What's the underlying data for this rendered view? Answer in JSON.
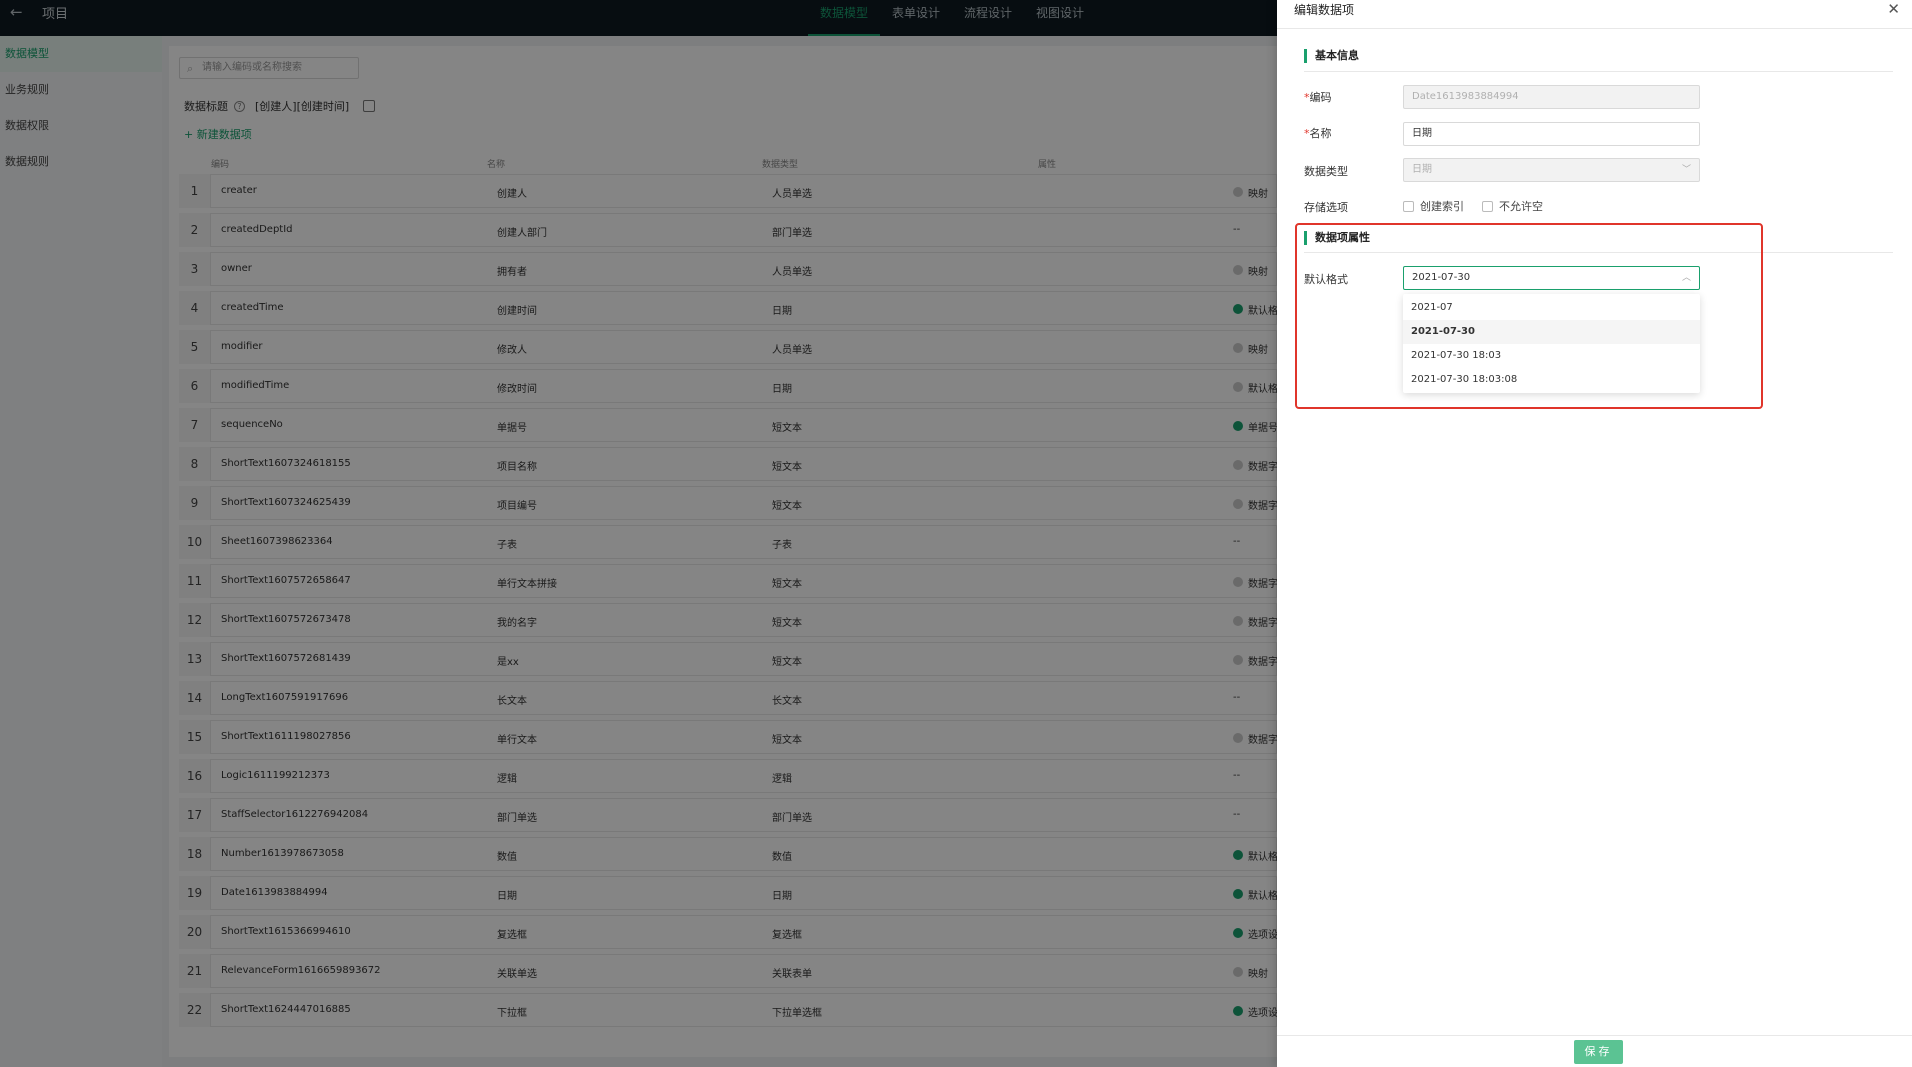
{
  "topbar": {
    "back_icon": "arrow-left-icon",
    "title": "项目",
    "tabs": [
      {
        "label": "数据模型",
        "active": true
      },
      {
        "label": "表单设计",
        "active": false
      },
      {
        "label": "流程设计",
        "active": false
      },
      {
        "label": "视图设计",
        "active": false
      }
    ]
  },
  "sidebar": {
    "items": [
      {
        "label": "数据模型",
        "active": true
      },
      {
        "label": "业务规则",
        "active": false
      },
      {
        "label": "数据权限",
        "active": false
      },
      {
        "label": "数据规则",
        "active": false
      }
    ]
  },
  "main": {
    "search_placeholder": "请输入编码或名称搜索",
    "data_title_label": "数据标题",
    "data_title_value": "[创建人][创建时间]",
    "add_item": "+ 新建数据项",
    "columns": [
      "编码",
      "名称",
      "数据类型",
      "属性"
    ],
    "rows": [
      {
        "n": "1",
        "code": "creater",
        "name": "创建人",
        "type": "人员单选",
        "attr": "映射",
        "dot": "gray"
      },
      {
        "n": "2",
        "code": "createdDeptId",
        "name": "创建人部门",
        "type": "部门单选",
        "attr": "--",
        "dot": "none"
      },
      {
        "n": "3",
        "code": "owner",
        "name": "拥有者",
        "type": "人员单选",
        "attr": "映射",
        "dot": "gray"
      },
      {
        "n": "4",
        "code": "createdTime",
        "name": "创建时间",
        "type": "日期",
        "attr": "默认格",
        "dot": "green"
      },
      {
        "n": "5",
        "code": "modifier",
        "name": "修改人",
        "type": "人员单选",
        "attr": "映射",
        "dot": "gray"
      },
      {
        "n": "6",
        "code": "modifiedTime",
        "name": "修改时间",
        "type": "日期",
        "attr": "默认格",
        "dot": "gray"
      },
      {
        "n": "7",
        "code": "sequenceNo",
        "name": "单据号",
        "type": "短文本",
        "attr": "单据号",
        "dot": "green"
      },
      {
        "n": "8",
        "code": "ShortText1607324618155",
        "name": "项目名称",
        "type": "短文本",
        "attr": "数据字",
        "dot": "gray"
      },
      {
        "n": "9",
        "code": "ShortText1607324625439",
        "name": "项目编号",
        "type": "短文本",
        "attr": "数据字",
        "dot": "gray"
      },
      {
        "n": "10",
        "code": "Sheet1607398623364",
        "name": "子表",
        "type": "子表",
        "attr": "--",
        "dot": "none"
      },
      {
        "n": "11",
        "code": "ShortText1607572658647",
        "name": "单行文本拼接",
        "type": "短文本",
        "attr": "数据字",
        "dot": "gray"
      },
      {
        "n": "12",
        "code": "ShortText1607572673478",
        "name": "我的名字",
        "type": "短文本",
        "attr": "数据字",
        "dot": "gray"
      },
      {
        "n": "13",
        "code": "ShortText1607572681439",
        "name": "是xx",
        "type": "短文本",
        "attr": "数据字",
        "dot": "gray"
      },
      {
        "n": "14",
        "code": "LongText1607591917696",
        "name": "长文本",
        "type": "长文本",
        "attr": "--",
        "dot": "none"
      },
      {
        "n": "15",
        "code": "ShortText1611198027856",
        "name": "单行文本",
        "type": "短文本",
        "attr": "数据字",
        "dot": "gray"
      },
      {
        "n": "16",
        "code": "Logic1611199212373",
        "name": "逻辑",
        "type": "逻辑",
        "attr": "--",
        "dot": "none"
      },
      {
        "n": "17",
        "code": "StaffSelector1612276942084",
        "name": "部门单选",
        "type": "部门单选",
        "attr": "--",
        "dot": "none"
      },
      {
        "n": "18",
        "code": "Number1613978673058",
        "name": "数值",
        "type": "数值",
        "attr": "默认格",
        "dot": "green"
      },
      {
        "n": "19",
        "code": "Date1613983884994",
        "name": "日期",
        "type": "日期",
        "attr": "默认格",
        "dot": "green"
      },
      {
        "n": "20",
        "code": "ShortText1615366994610",
        "name": "复选框",
        "type": "复选框",
        "attr": "选项设",
        "dot": "green"
      },
      {
        "n": "21",
        "code": "RelevanceForm1616659893672",
        "name": "关联单选",
        "type": "关联表单",
        "attr": "映射",
        "dot": "gray"
      },
      {
        "n": "22",
        "code": "ShortText1624447016885",
        "name": "下拉框",
        "type": "下拉单选框",
        "attr": "选项设",
        "dot": "green"
      }
    ]
  },
  "drawer": {
    "title": "编辑数据项",
    "close_icon": "close-icon",
    "basic_section": "基本信息",
    "code_label": "编码",
    "code_value": "Date1613983884994",
    "name_label": "名称",
    "name_value": "日期",
    "type_label": "数据类型",
    "type_value": "日期",
    "storage_label": "存储选项",
    "index_option": "创建索引",
    "notnull_option": "不允许空",
    "props_section": "数据项属性",
    "format_label": "默认格式",
    "format_value": "2021-07-30",
    "format_options": [
      {
        "label": "2021-07",
        "selected": false
      },
      {
        "label": "2021-07-30",
        "selected": true
      },
      {
        "label": "2021-07-30 18:03",
        "selected": false
      },
      {
        "label": "2021-07-30 18:03:08",
        "selected": false
      }
    ],
    "save_label": "保存",
    "accent_color": "#1aa06d",
    "highlight_color": "#e0352b"
  }
}
